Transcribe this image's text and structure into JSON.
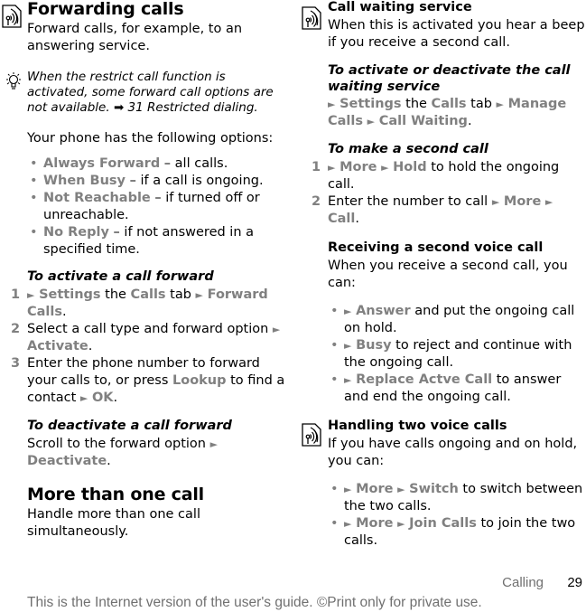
{
  "left": {
    "title": "Forwarding calls",
    "intro": "Forward calls, for example, to an answering service.",
    "note": {
      "text": "When the restrict call function is activated, some forward call options are not available.",
      "ref": "31 Restricted dialing."
    },
    "options_intro": "Your phone has the following options:",
    "options": [
      {
        "term": "Always Forward",
        "desc": " – all calls."
      },
      {
        "term": "When Busy",
        "desc": " – if a call is ongoing."
      },
      {
        "term": "Not Reachable",
        "desc": " – if turned off or unreachable."
      },
      {
        "term": "No Reply",
        "desc": " – if not answered in a specified time."
      }
    ],
    "activate_heading": "To activate a call forward",
    "activate_steps": {
      "s1": {
        "num": "1",
        "settings": "Settings",
        "the": " the ",
        "calls": "Calls",
        "tab": " tab ",
        "forward_calls": "Forward Calls",
        "end": "."
      },
      "s2": {
        "num": "2",
        "text": "Select a call type and forward option ",
        "activate": "Activate",
        "end": "."
      },
      "s3": {
        "num": "3",
        "text": "Enter the phone number to forward your calls to, or press ",
        "lookup": "Lookup",
        "mid": " to find a contact ",
        "ok": "OK",
        "end": "."
      }
    },
    "deactivate_heading": "To deactivate a call forward",
    "deactivate_text": "Scroll to the forward option ",
    "deactivate_cmd": "Deactivate",
    "more_title": "More than one call",
    "more_text": "Handle more than one call simultaneously."
  },
  "right": {
    "waiting_title": "Call waiting service",
    "waiting_text": "When this is activated you hear a beep if you receive a second call.",
    "waiting_heading": "To activate or deactivate the call waiting service",
    "waiting_path": {
      "settings": "Settings",
      "the": " the ",
      "calls": "Calls",
      "tab": " tab ",
      "manage": "Manage Calls",
      "waiting": "Call Waiting",
      "end": "."
    },
    "second_heading": "To make a second call",
    "second_steps": {
      "s1": {
        "num": "1",
        "more": "More",
        "hold": "Hold",
        "text": " to hold the ongoing call."
      },
      "s2": {
        "num": "2",
        "text": "Enter the number to call ",
        "more": "More",
        "call": "Call",
        "end": "."
      }
    },
    "receiving_title": "Receiving a second voice call",
    "receiving_text": "When you receive a second call, you can:",
    "receiving_options": [
      {
        "cmd": "Answer",
        "text": " and put the ongoing call on hold."
      },
      {
        "cmd": "Busy",
        "text": " to reject and continue with the ongoing call."
      },
      {
        "cmd": "Replace Actve Call",
        "text": " to answer and end the ongoing call."
      }
    ],
    "handling_title": "Handling two voice calls",
    "handling_text": "If you have calls ongoing and on hold, you can:",
    "handling_options": [
      {
        "more": "More",
        "cmd": "Switch",
        "text": " to switch between the two calls."
      },
      {
        "more": "More",
        "cmd": "Join Calls",
        "text": " to join the two calls."
      }
    ]
  },
  "icons": {
    "operator_service": "antenna-signal-icon",
    "tip": "lightbulb-icon",
    "reference_arrow": "arrow-right-icon",
    "menu_arrow": "triangle-right-icon",
    "bullet": "bullet-icon"
  },
  "colors": {
    "command_gray": "#808080",
    "footer_gray": "#707070"
  },
  "footer": {
    "section": "Calling",
    "page": "29",
    "disclaimer": "This is the Internet version of the user's guide. ©Print only for private use."
  },
  "glyphs": {
    "arrow": "►",
    "bullet": "•",
    "ref_arrow": "➡"
  }
}
